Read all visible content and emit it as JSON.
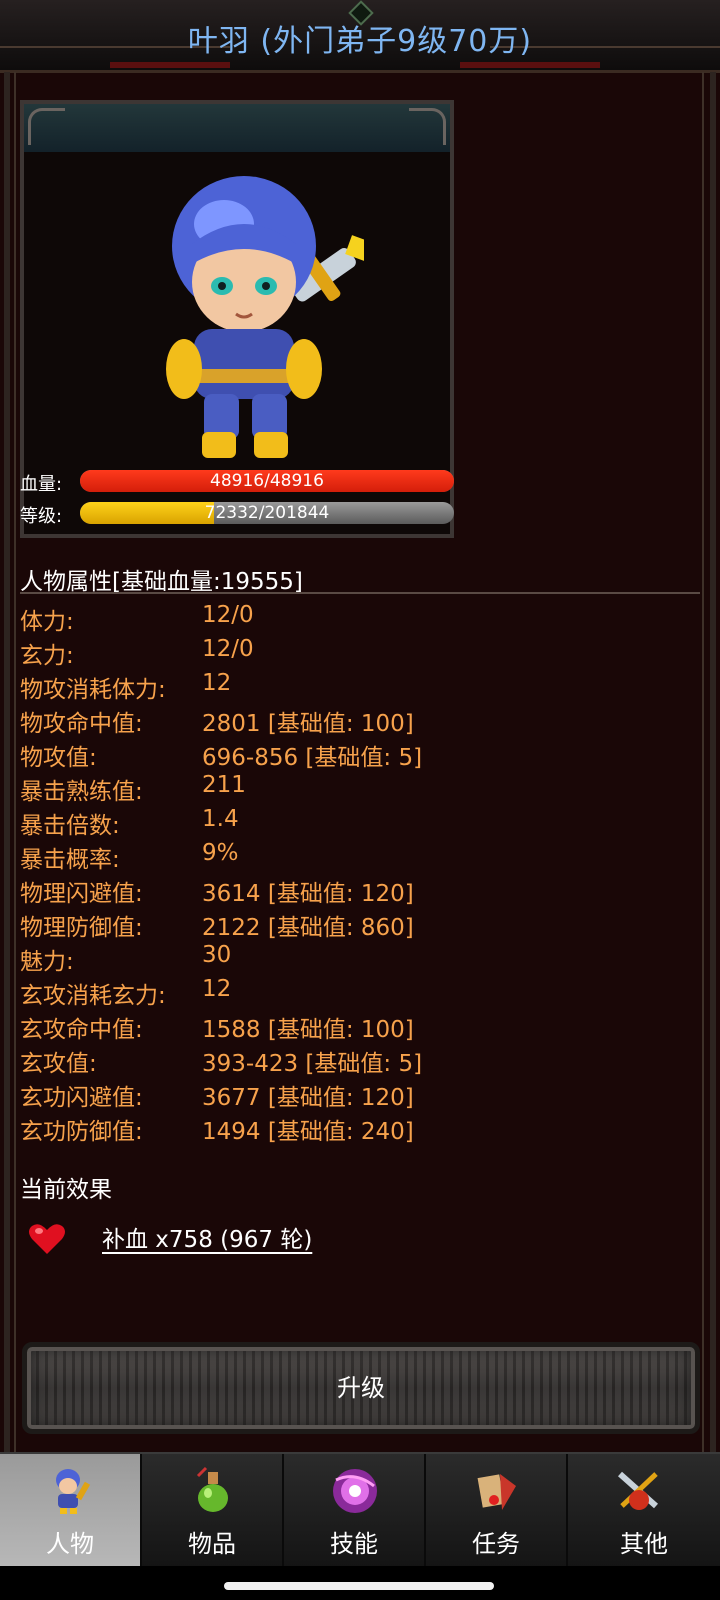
{
  "header": {
    "title": "叶羽 (外门弟子9级70万)"
  },
  "portrait": {
    "hp_label": "血量:",
    "hp_text": "48916/48916",
    "hp_fraction": 1.0,
    "level_label": "等级:",
    "level_text": "72332/201844",
    "level_fraction": 0.358
  },
  "attributes": {
    "title": "人物属性[基础血量:19555]",
    "rows": [
      {
        "name": "体力:",
        "value": "12/0"
      },
      {
        "name": "玄力:",
        "value": "12/0"
      },
      {
        "name": "物攻消耗体力:",
        "value": "12"
      },
      {
        "name": "物攻命中值:",
        "value": "2801 [基础值: 100]"
      },
      {
        "name": "物攻值:",
        "value": "696-856 [基础值: 5]"
      },
      {
        "name": "暴击熟练值:",
        "value": "211"
      },
      {
        "name": "暴击倍数:",
        "value": "1.4"
      },
      {
        "name": "暴击概率:",
        "value": "9%"
      },
      {
        "name": "物理闪避值:",
        "value": "3614 [基础值: 120]"
      },
      {
        "name": "物理防御值:",
        "value": "2122 [基础值: 860]"
      },
      {
        "name": "魅力:",
        "value": "30"
      },
      {
        "name": "玄攻消耗玄力:",
        "value": "12"
      },
      {
        "name": "玄攻命中值:",
        "value": "1588 [基础值: 100]"
      },
      {
        "name": "玄攻值:",
        "value": "393-423 [基础值: 5]"
      },
      {
        "name": "玄功闪避值:",
        "value": "3677 [基础值: 120]"
      },
      {
        "name": "玄功防御值:",
        "value": "1494 [基础值: 240]"
      }
    ]
  },
  "effects": {
    "title": "当前效果",
    "items": [
      {
        "icon": "heart-icon",
        "text": "补血 x758 (967 轮)"
      }
    ]
  },
  "upgrade_button": {
    "label": "升级"
  },
  "nav": {
    "tabs": [
      {
        "label": "人物",
        "icon": "character-icon",
        "active": true
      },
      {
        "label": "物品",
        "icon": "potion-icon",
        "active": false
      },
      {
        "label": "技能",
        "icon": "skill-orb-icon",
        "active": false
      },
      {
        "label": "任务",
        "icon": "quest-icon",
        "active": false
      },
      {
        "label": "其他",
        "icon": "settings-icon",
        "active": false
      }
    ]
  },
  "colors": {
    "title": "#7fb6f2",
    "attribute": "#f7a24c",
    "hp": "#e8230f",
    "xp": "#f0c000"
  }
}
